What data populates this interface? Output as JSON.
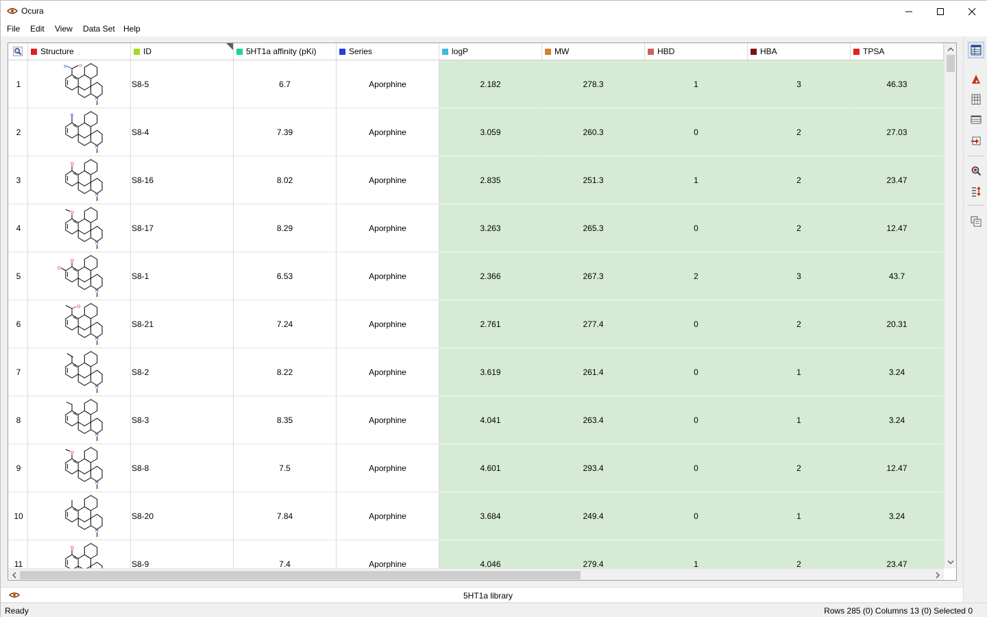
{
  "window": {
    "title": "Ocura"
  },
  "menu": [
    "File",
    "Edit",
    "View",
    "Data Set",
    "Help"
  ],
  "columns": [
    {
      "name": "Structure",
      "color": "#e02020"
    },
    {
      "name": "ID",
      "color": "#a8d820"
    },
    {
      "name": "5HT1a affinity (pKi)",
      "color": "#20d0a0"
    },
    {
      "name": "Series",
      "color": "#2040e0"
    },
    {
      "name": "logP",
      "color": "#40b8e0"
    },
    {
      "name": "MW",
      "color": "#d08030"
    },
    {
      "name": "HBD",
      "color": "#d06060"
    },
    {
      "name": "HBA",
      "color": "#801010"
    },
    {
      "name": "TPSA",
      "color": "#e02020"
    }
  ],
  "rows": [
    {
      "n": "1",
      "id": "S8-5",
      "aff": "6.7",
      "series": "Aporphine",
      "logp": "2.182",
      "mw": "278.3",
      "hbd": "1",
      "hba": "3",
      "tpsa": "46.33",
      "sub": "amide"
    },
    {
      "n": "2",
      "id": "S8-4",
      "aff": "7.39",
      "series": "Aporphine",
      "logp": "3.059",
      "mw": "260.3",
      "hbd": "0",
      "hba": "2",
      "tpsa": "27.03",
      "sub": "nitrile"
    },
    {
      "n": "3",
      "id": "S8-16",
      "aff": "8.02",
      "series": "Aporphine",
      "logp": "2.835",
      "mw": "251.3",
      "hbd": "1",
      "hba": "2",
      "tpsa": "23.47",
      "sub": "hydroxy"
    },
    {
      "n": "4",
      "id": "S8-17",
      "aff": "8.29",
      "series": "Aporphine",
      "logp": "3.263",
      "mw": "265.3",
      "hbd": "0",
      "hba": "2",
      "tpsa": "12.47",
      "sub": "methoxy"
    },
    {
      "n": "5",
      "id": "S8-1",
      "aff": "6.53",
      "series": "Aporphine",
      "logp": "2.366",
      "mw": "267.3",
      "hbd": "2",
      "hba": "3",
      "tpsa": "43.7",
      "sub": "dihydroxy"
    },
    {
      "n": "6",
      "id": "S8-21",
      "aff": "7.24",
      "series": "Aporphine",
      "logp": "2.761",
      "mw": "277.4",
      "hbd": "0",
      "hba": "2",
      "tpsa": "20.31",
      "sub": "acetyl"
    },
    {
      "n": "7",
      "id": "S8-2",
      "aff": "8.22",
      "series": "Aporphine",
      "logp": "3.619",
      "mw": "261.4",
      "hbd": "0",
      "hba": "1",
      "tpsa": "3.24",
      "sub": "vinyl"
    },
    {
      "n": "8",
      "id": "S8-3",
      "aff": "8.35",
      "series": "Aporphine",
      "logp": "4.041",
      "mw": "263.4",
      "hbd": "0",
      "hba": "1",
      "tpsa": "3.24",
      "sub": "ethyl"
    },
    {
      "n": "9",
      "id": "S8-8",
      "aff": "7.5",
      "series": "Aporphine",
      "logp": "4.601",
      "mw": "293.4",
      "hbd": "0",
      "hba": "2",
      "tpsa": "12.47",
      "sub": "methoxy-propyl"
    },
    {
      "n": "10",
      "id": "S8-20",
      "aff": "7.84",
      "series": "Aporphine",
      "logp": "3.684",
      "mw": "249.4",
      "hbd": "0",
      "hba": "1",
      "tpsa": "3.24",
      "sub": "methyl"
    },
    {
      "n": "11",
      "id": "S8-9",
      "aff": "7.4",
      "series": "Aporphine",
      "logp": "4.046",
      "mw": "279.4",
      "hbd": "1",
      "hba": "2",
      "tpsa": "23.47",
      "sub": "hydroxy-small"
    }
  ],
  "tab": {
    "label": "5HT1a library"
  },
  "status": {
    "left": "Ready",
    "right": "Rows 285 (0) Columns 13 (0) Selected 0"
  },
  "toolbar_icons": [
    "table-view-icon",
    "chart-icon",
    "columns-icon",
    "rows-icon",
    "import-icon",
    "search-icon",
    "sort-icon",
    "copy-icon"
  ]
}
